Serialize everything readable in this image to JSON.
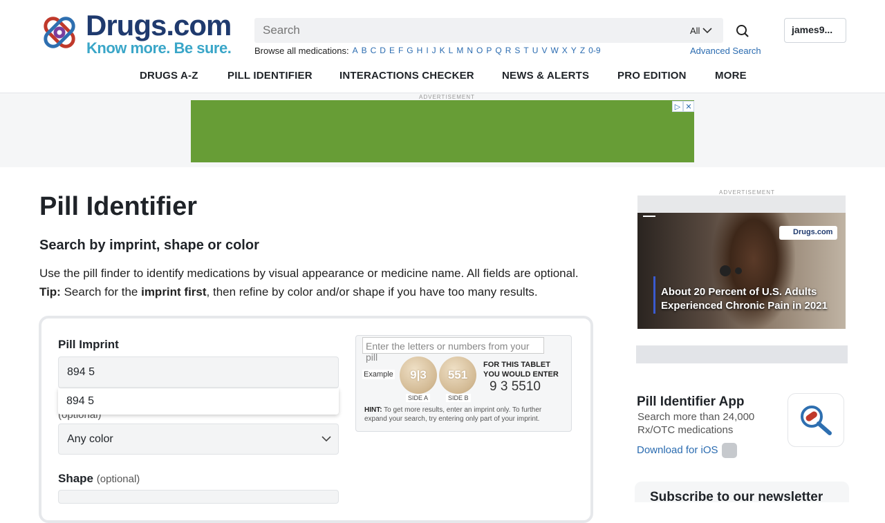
{
  "header": {
    "logo_text": "Drugs.com",
    "tagline": "Know more. Be sure.",
    "search_placeholder": "Search",
    "search_scope": "All",
    "user_label": "james9...",
    "browse_label": "Browse all medications:",
    "letters": [
      "A",
      "B",
      "C",
      "D",
      "E",
      "F",
      "G",
      "H",
      "I",
      "J",
      "K",
      "L",
      "M",
      "N",
      "O",
      "P",
      "Q",
      "R",
      "S",
      "T",
      "U",
      "V",
      "W",
      "X",
      "Y",
      "Z",
      "0-9"
    ],
    "advanced_search": "Advanced Search"
  },
  "nav": {
    "drugs_az": "DRUGS A-Z",
    "pill_identifier": "PILL IDENTIFIER",
    "interactions": "INTERACTIONS CHECKER",
    "news": "NEWS & ALERTS",
    "pro": "PRO EDITION",
    "more": "MORE"
  },
  "ads": {
    "label": "ADVERTISEMENT",
    "video_badge": "Drugs.com",
    "video_line1": "About 20 Percent of U.S. Adults",
    "video_line2": "Experienced Chronic Pain in 2021"
  },
  "main": {
    "title": "Pill Identifier",
    "subhead": "Search by imprint, shape or color",
    "intro": "Use the pill finder to identify medications by visual appearance or medicine name. All fields are optional.",
    "tip_lead": "Tip:",
    "tip_a": " Search for the ",
    "tip_bold": "imprint first",
    "tip_b": ", then refine by color and/or shape if you have too many results."
  },
  "form": {
    "imprint_label": "Pill Imprint",
    "imprint_value": "894 5",
    "suggestion": "894 5",
    "color_label_hidden": "(optional)",
    "color_value": "Any color",
    "shape_label": "Shape",
    "shape_optional": "(optional)"
  },
  "example": {
    "input_placeholder": "Enter the letters or numbers from your pill",
    "example_label": "Example",
    "pill_a": "9|3",
    "pill_b": "551",
    "side_a": "SIDE A",
    "side_b": "SIDE B",
    "for_tablet": "FOR THIS TABLET",
    "you_would_enter": "YOU WOULD ENTER",
    "result": "9 3 5510",
    "hint_label": "HINT:",
    "hint_line1": " To get more results, enter an imprint only. To further",
    "hint_line2": "expand your search, try entering only part of your imprint."
  },
  "sidebar": {
    "app_title": "Pill Identifier App",
    "app_line1": "Search more than 24,000",
    "app_line2": "Rx/OTC medications",
    "app_link": "Download for iOS",
    "newsletter": "Subscribe to our newsletter"
  },
  "colors": {
    "brand_navy": "#1f3a6e",
    "brand_teal": "#3aa6c8",
    "link": "#2a6bb0",
    "ad_green": "#679d36"
  }
}
